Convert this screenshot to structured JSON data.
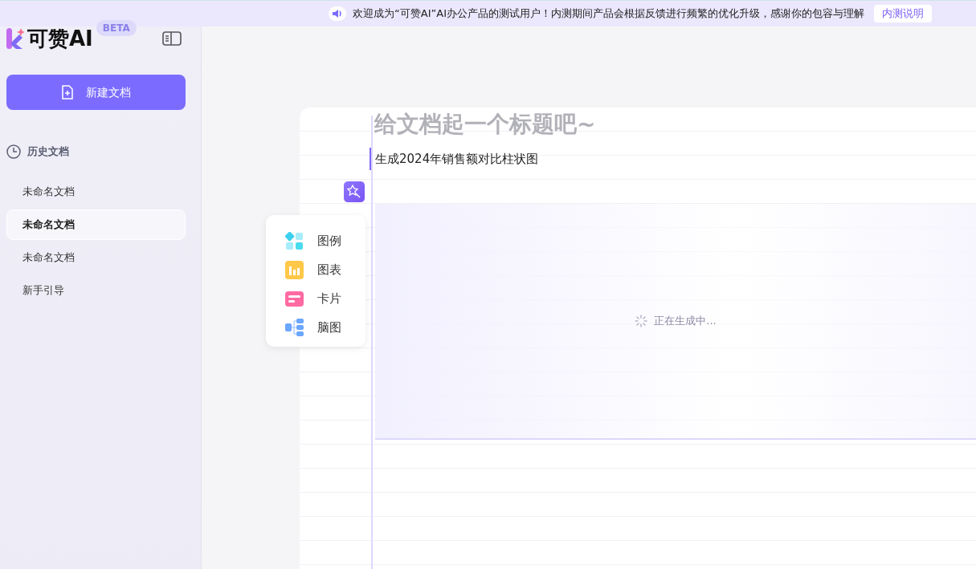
{
  "banner": {
    "message": "欢迎成为“可赞AI”AI办公产品的测试用户！内测期间产品会根据反馈进行频繁的优化升级，感谢你的包容与理解",
    "link": "内测说明"
  },
  "sidebar": {
    "logo": "可赞AI",
    "badge": "BETA",
    "new_button": "新建文档",
    "history_title": "历史文档",
    "items": [
      {
        "label": "未命名文档",
        "selected": false
      },
      {
        "label": "未命名文档",
        "selected": true
      },
      {
        "label": "未命名文档",
        "selected": false
      },
      {
        "label": "新手引导",
        "selected": false
      }
    ]
  },
  "editor": {
    "title_placeholder": "给文档起一个标题吧~",
    "prompt": "生成2024年销售额对比柱状图",
    "menu": [
      {
        "kind": "legend",
        "label": "图例"
      },
      {
        "kind": "chart",
        "label": "图表"
      },
      {
        "kind": "card",
        "label": "卡片"
      },
      {
        "kind": "mindmap",
        "label": "脑图"
      }
    ],
    "status": "正在生成中..."
  }
}
